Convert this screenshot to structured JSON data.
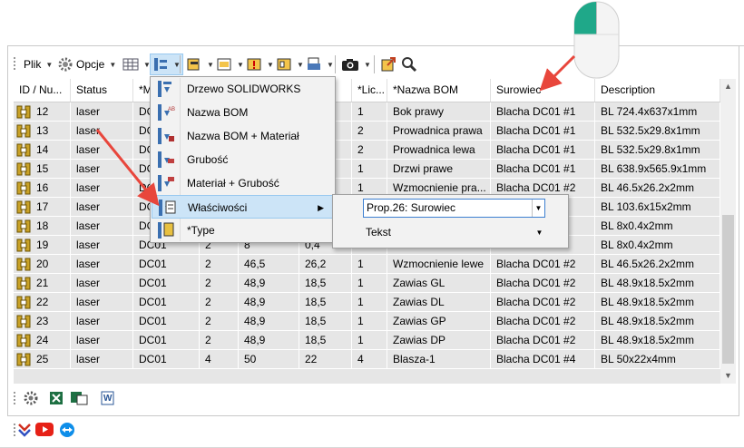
{
  "toolbar": {
    "plik_label": "Plik",
    "opcje_label": "Opcje"
  },
  "grid": {
    "columns": [
      "ID / Nu...",
      "Status",
      "*M",
      "",
      "",
      "",
      "*Lic...",
      "*Nazwa BOM",
      "Surowiec",
      "Description"
    ],
    "rows": [
      {
        "id": "12",
        "status": "laser",
        "m": "DC",
        "c4": "",
        "c5": "",
        "c6": "",
        "lic": "1",
        "nazwa": "Bok prawy",
        "surowiec": "Blacha DC01 #1",
        "desc": "BL 724.4x637x1mm"
      },
      {
        "id": "13",
        "status": "laser",
        "m": "DC",
        "c4": "",
        "c5": "",
        "c6": "",
        "lic": "2",
        "nazwa": "Prowadnica prawa",
        "surowiec": "Blacha DC01 #1",
        "desc": "BL 532.5x29.8x1mm"
      },
      {
        "id": "14",
        "status": "laser",
        "m": "DC",
        "c4": "",
        "c5": "",
        "c6": "",
        "lic": "2",
        "nazwa": "Prowadnica lewa",
        "surowiec": "Blacha DC01 #1",
        "desc": "BL 532.5x29.8x1mm"
      },
      {
        "id": "15",
        "status": "laser",
        "m": "DC",
        "c4": "",
        "c5": "",
        "c6": "",
        "lic": "1",
        "nazwa": "Drzwi prawe",
        "surowiec": "Blacha DC01 #1",
        "desc": "BL 638.9x565.9x1mm"
      },
      {
        "id": "16",
        "status": "laser",
        "m": "DC",
        "c4": "",
        "c5": "",
        "c6": "",
        "lic": "1",
        "nazwa": "Wzmocnienie pra...",
        "surowiec": "Blacha DC01 #2",
        "desc": "BL 46.5x26.2x2mm"
      },
      {
        "id": "17",
        "status": "laser",
        "m": "DC",
        "c4": "",
        "c5": "",
        "c6": "",
        "lic": "",
        "nazwa": "",
        "surowiec": "",
        "desc": "BL 103.6x15x2mm"
      },
      {
        "id": "18",
        "status": "laser",
        "m": "DC",
        "c4": "",
        "c5": "",
        "c6": "",
        "lic": "",
        "nazwa": "",
        "surowiec": "",
        "desc": "BL 8x0.4x2mm"
      },
      {
        "id": "19",
        "status": "laser",
        "m": "DC01",
        "c4": "2",
        "c5": "8",
        "c6": "0,4",
        "lic": "",
        "nazwa": "",
        "surowiec": "",
        "desc": "BL 8x0.4x2mm"
      },
      {
        "id": "20",
        "status": "laser",
        "m": "DC01",
        "c4": "2",
        "c5": "46,5",
        "c6": "26,2",
        "lic": "1",
        "nazwa": "Wzmocnienie lewe",
        "surowiec": "Blacha DC01 #2",
        "desc": "BL 46.5x26.2x2mm"
      },
      {
        "id": "21",
        "status": "laser",
        "m": "DC01",
        "c4": "2",
        "c5": "48,9",
        "c6": "18,5",
        "lic": "1",
        "nazwa": "Zawias GL",
        "surowiec": "Blacha DC01 #2",
        "desc": "BL 48.9x18.5x2mm"
      },
      {
        "id": "22",
        "status": "laser",
        "m": "DC01",
        "c4": "2",
        "c5": "48,9",
        "c6": "18,5",
        "lic": "1",
        "nazwa": "Zawias DL",
        "surowiec": "Blacha DC01 #2",
        "desc": "BL 48.9x18.5x2mm"
      },
      {
        "id": "23",
        "status": "laser",
        "m": "DC01",
        "c4": "2",
        "c5": "48,9",
        "c6": "18,5",
        "lic": "1",
        "nazwa": "Zawias GP",
        "surowiec": "Blacha DC01 #2",
        "desc": "BL 48.9x18.5x2mm"
      },
      {
        "id": "24",
        "status": "laser",
        "m": "DC01",
        "c4": "2",
        "c5": "48,9",
        "c6": "18,5",
        "lic": "1",
        "nazwa": "Zawias DP",
        "surowiec": "Blacha DC01 #2",
        "desc": "BL 48.9x18.5x2mm"
      },
      {
        "id": "25",
        "status": "laser",
        "m": "DC01",
        "c4": "4",
        "c5": "50",
        "c6": "22",
        "lic": "4",
        "nazwa": "Blasza-1",
        "surowiec": "Blacha DC01 #4",
        "desc": "BL 50x22x4mm"
      }
    ]
  },
  "menu": {
    "items": [
      {
        "label": "Drzewo SOLIDWORKS"
      },
      {
        "label": "Nazwa BOM"
      },
      {
        "label": "Nazwa BOM + Materiał"
      },
      {
        "label": "Grubość"
      },
      {
        "label": "Materiał + Grubość"
      },
      {
        "label": "Właściwości"
      },
      {
        "label": "*Type"
      }
    ]
  },
  "submenu": {
    "property_value": "Prop.26: Surowiec",
    "mode_value": "Tekst"
  },
  "colors": {
    "selection": "#cce4f7",
    "arrow": "#e8463c",
    "grid_bg": "#e6e6e6"
  }
}
